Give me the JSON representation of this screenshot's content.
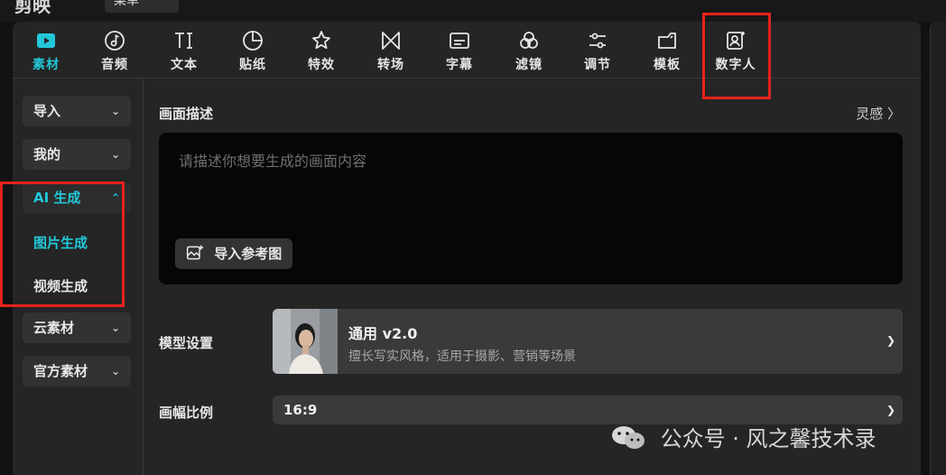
{
  "app": {
    "title": "剪映",
    "top_dropdown_value": "菜单"
  },
  "tabs": [
    {
      "label": "素材",
      "icon": "play-square-icon",
      "active": true
    },
    {
      "label": "音频",
      "icon": "music-note-icon"
    },
    {
      "label": "文本",
      "icon": "text-ti-icon"
    },
    {
      "label": "贴纸",
      "icon": "sticker-icon"
    },
    {
      "label": "特效",
      "icon": "sparkle-star-icon"
    },
    {
      "label": "转场",
      "icon": "transition-bowtie-icon"
    },
    {
      "label": "字幕",
      "icon": "subtitle-icon"
    },
    {
      "label": "滤镜",
      "icon": "filter-circles-icon"
    },
    {
      "label": "调节",
      "icon": "adjust-sliders-icon"
    },
    {
      "label": "模板",
      "icon": "template-icon"
    },
    {
      "label": "数字人",
      "icon": "digital-human-icon"
    }
  ],
  "sidebar": {
    "items": [
      {
        "label": "导入"
      },
      {
        "label": "我的"
      },
      {
        "label": "AI 生成",
        "expanded": true
      },
      {
        "label": "云素材"
      },
      {
        "label": "官方素材"
      }
    ],
    "ai_sub": [
      {
        "label": "图片生成",
        "active": true
      },
      {
        "label": "视频生成"
      }
    ]
  },
  "main": {
    "desc_label": "画面描述",
    "inspire_label": "灵感 〉",
    "prompt_placeholder": "请描述你想要生成的画面内容",
    "import_ref_label": "导入参考图",
    "model_label": "模型设置",
    "model_name": "通用 v2.0",
    "model_desc": "擅长写实风格，适用于摄影、营销等场景",
    "ratio_label": "画幅比例",
    "ratio_value": "16:9"
  },
  "watermark": "公众号 · 风之馨技术录",
  "colors": {
    "accent": "#22c8d8",
    "highlight_box": "#e8231c",
    "panel": "#252525"
  }
}
